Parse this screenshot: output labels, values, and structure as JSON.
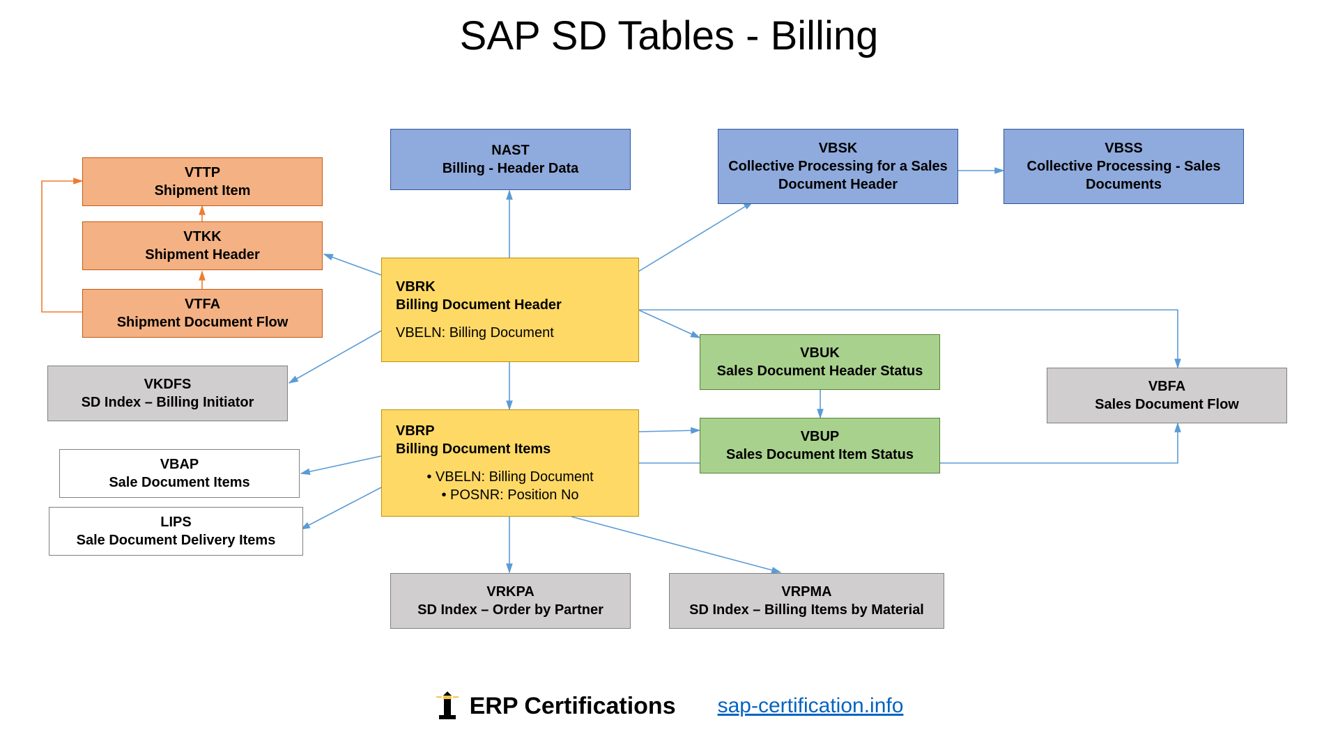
{
  "title": "SAP SD Tables - Billing",
  "boxes": {
    "vttp": {
      "name": "VTTP",
      "desc": "Shipment Item"
    },
    "vtkk": {
      "name": "VTKK",
      "desc": "Shipment Header"
    },
    "vtfa": {
      "name": "VTFA",
      "desc": "Shipment Document Flow"
    },
    "nast": {
      "name": "NAST",
      "desc": "Billing - Header Data"
    },
    "vbsk": {
      "name": "VBSK",
      "desc": "Collective Processing for a Sales Document Header"
    },
    "vbss": {
      "name": "VBSS",
      "desc": "Collective Processing - Sales Documents"
    },
    "vbrk": {
      "name": "VBRK",
      "desc": "Billing Document Header",
      "extra": "VBELN: Billing Document"
    },
    "vbrp": {
      "name": "VBRP",
      "desc": "Billing Document Items",
      "extra_lines": [
        "•   VBELN: Billing Document",
        "•   POSNR: Position No"
      ]
    },
    "vkdfs": {
      "name": "VKDFS",
      "desc": "SD Index – Billing Initiator"
    },
    "vbap": {
      "name": "VBAP",
      "desc": "Sale Document Items"
    },
    "lips": {
      "name": "LIPS",
      "desc": "Sale Document Delivery Items"
    },
    "vbuk": {
      "name": "VBUK",
      "desc": "Sales Document Header Status"
    },
    "vbup": {
      "name": "VBUP",
      "desc": "Sales Document Item Status"
    },
    "vbfa": {
      "name": "VBFA",
      "desc": "Sales Document Flow"
    },
    "vrkpa": {
      "name": "VRKPA",
      "desc": "SD Index – Order by Partner"
    },
    "vrpma": {
      "name": "VRPMA",
      "desc": "SD Index – Billing Items by Material"
    }
  },
  "footer": {
    "brand": "ERP Certifications",
    "link": "sap-certification.info"
  }
}
